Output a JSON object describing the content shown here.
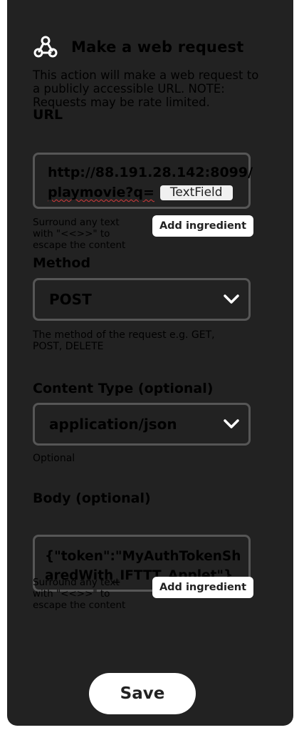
{
  "header": {
    "icon": "webhooks-icon",
    "title": "Make a web request",
    "description": "This action will make a web request to a publicly accessible URL. NOTE: Requests may be rate limited."
  },
  "url": {
    "label": "URL",
    "line1": "http://88.191.28.142:8099/",
    "line2": "playmovie?q=",
    "ingredient": "TextField",
    "hint": "Surround any text with \"<<>>\" to escape the content",
    "add_ingredient": "Add ingredient"
  },
  "method": {
    "label": "Method",
    "value": "POST",
    "hint": "The method of the request e.g. GET, POST, DELETE"
  },
  "content_type": {
    "label": "Content Type (optional)",
    "value": "application/json",
    "hint": "Optional"
  },
  "body": {
    "label": "Body (optional)",
    "value": "{\"token\":\"MyAuthTokenSharedWith_IFTTT_Applet\"}",
    "hint": "Surround any text with \"<<>>\" to escape the content",
    "add_ingredient": "Add ingredient"
  },
  "save_label": "Save",
  "colors": {
    "panel": "#222222",
    "field_border": "#565656",
    "text": "#ffffff"
  }
}
